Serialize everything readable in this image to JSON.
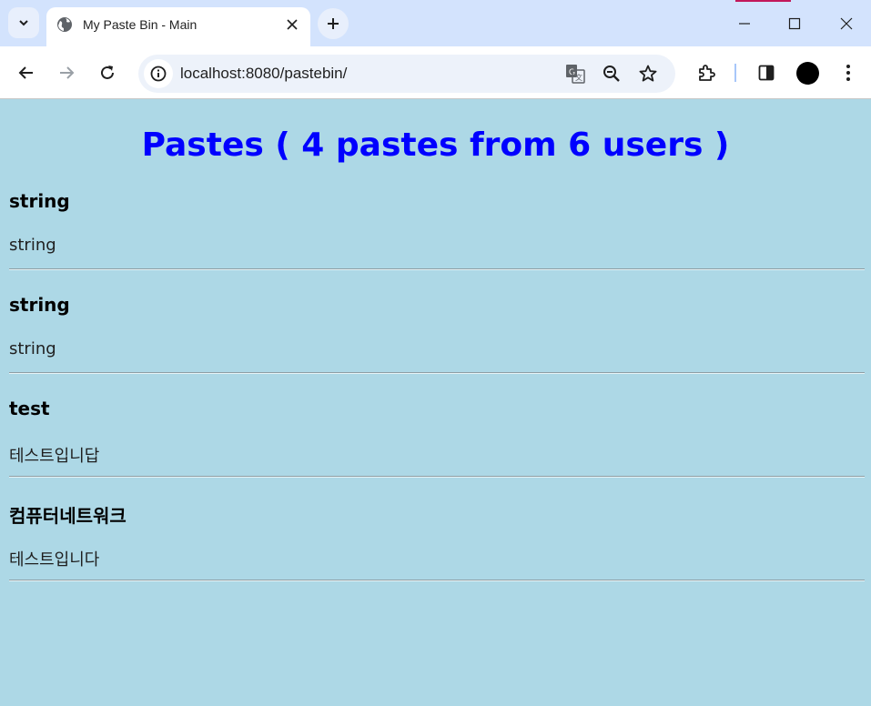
{
  "browser": {
    "tab_title": "My Paste Bin - Main",
    "url": "localhost:8080/pastebin/"
  },
  "page": {
    "title": "Pastes ( 4 pastes from 6 users )",
    "pastes": [
      {
        "title": "string",
        "content": "string"
      },
      {
        "title": "string",
        "content": "string"
      },
      {
        "title": "test",
        "content": "테스트입니답"
      },
      {
        "title": "컴퓨터네트워크",
        "content": "테스트입니다"
      }
    ]
  },
  "colors": {
    "page_background": "#add8e6",
    "title_color": "#0000ff",
    "tabstrip": "#d3e3fd"
  }
}
